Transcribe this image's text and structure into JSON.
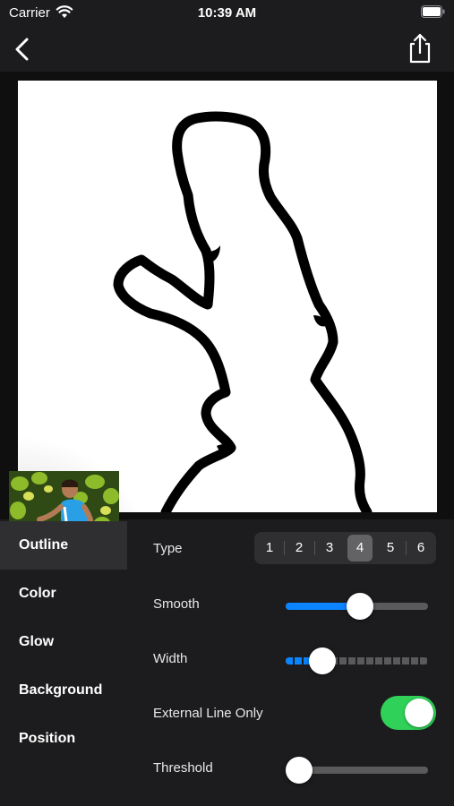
{
  "status_bar": {
    "carrier": "Carrier",
    "time": "10:39 AM"
  },
  "nav": {
    "back_icon": "chevron-left-icon",
    "share_icon": "share-icon"
  },
  "sidebar": {
    "items": [
      {
        "label": "Outline",
        "active": true
      },
      {
        "label": "Color",
        "active": false
      },
      {
        "label": "Glow",
        "active": false
      },
      {
        "label": "Background",
        "active": false
      },
      {
        "label": "Position",
        "active": false
      }
    ]
  },
  "outline_settings": {
    "type_label": "Type",
    "type_options": [
      "1",
      "2",
      "3",
      "4",
      "5",
      "6"
    ],
    "type_selected": "4",
    "smooth_label": "Smooth",
    "smooth_value": 0.52,
    "width_label": "Width",
    "width_value": 0.26,
    "external_line_label": "External Line Only",
    "external_line_on": true,
    "threshold_label": "Threshold",
    "threshold_value": 0.04
  },
  "colors": {
    "accent": "#0a84ff",
    "toggle_on": "#30d158",
    "background": "#1c1c1e"
  }
}
